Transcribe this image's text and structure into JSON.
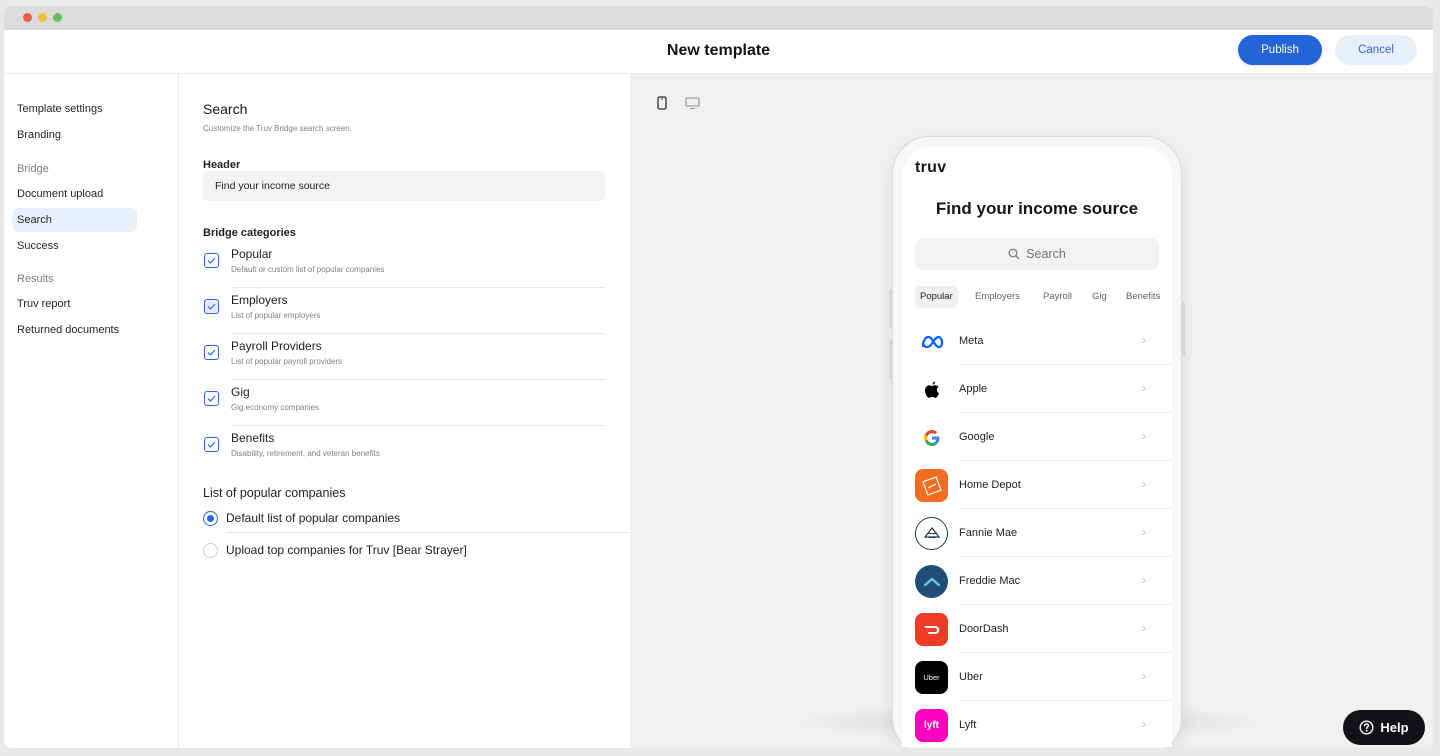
{
  "header": {
    "title": "New template",
    "publish_label": "Publish",
    "cancel_label": "Cancel"
  },
  "sidebar": {
    "items": [
      {
        "label": "Template settings",
        "type": "item"
      },
      {
        "label": "Branding",
        "type": "item"
      },
      {
        "label": "Bridge",
        "type": "group"
      },
      {
        "label": "Document upload",
        "type": "item"
      },
      {
        "label": "Search",
        "type": "item",
        "active": true
      },
      {
        "label": "Success",
        "type": "item"
      },
      {
        "label": "Results",
        "type": "group"
      },
      {
        "label": "Truv report",
        "type": "item"
      },
      {
        "label": "Returned documents",
        "type": "item"
      }
    ]
  },
  "settings": {
    "title": "Search",
    "subtitle": "Customize the Truv Bridge search screen.",
    "header_label": "Header",
    "header_value": "Find your income source",
    "categories_label": "Bridge categories",
    "categories": [
      {
        "name": "Popular",
        "desc": "Default or custom list of popular companies",
        "checked": true
      },
      {
        "name": "Employers",
        "desc": "List of popular employers",
        "checked": true
      },
      {
        "name": "Payroll Providers",
        "desc": "List of popular payroll providers",
        "checked": true
      },
      {
        "name": "Gig",
        "desc": "Gig economy companies",
        "checked": true
      },
      {
        "name": "Benefits",
        "desc": "Disability, retirement, and veteran benefits",
        "checked": true
      }
    ],
    "popular_label": "List of popular companies",
    "popular_options": [
      {
        "label": "Default list of popular companies",
        "selected": true
      },
      {
        "label": "Upload top companies for Truv [Bear Strayer]",
        "selected": false
      }
    ]
  },
  "preview": {
    "device_icons": [
      "mobile-icon",
      "desktop-icon"
    ],
    "logo": "truv",
    "title": "Find your income source",
    "search_placeholder": "Search",
    "tabs": [
      "Popular",
      "Employers",
      "Payroll",
      "Gig",
      "Benefits"
    ],
    "active_tab": "Popular",
    "companies": [
      {
        "name": "Meta",
        "icon": "meta-logo",
        "color": "#0866ff"
      },
      {
        "name": "Apple",
        "icon": "apple-logo",
        "color": "#000000"
      },
      {
        "name": "Google",
        "icon": "google-logo",
        "color": "#4285f4"
      },
      {
        "name": "Home Depot",
        "icon": "home-depot-logo",
        "color": "#f26c22"
      },
      {
        "name": "Fannie Mae",
        "icon": "fannie-mae-logo",
        "color": "#1d3b53"
      },
      {
        "name": "Freddie Mac",
        "icon": "freddie-mac-logo",
        "color": "#1f4e79"
      },
      {
        "name": "DoorDash",
        "icon": "doordash-logo",
        "color": "#ef3a25"
      },
      {
        "name": "Uber",
        "icon": "uber-logo",
        "color": "#000000",
        "text": "Uber"
      },
      {
        "name": "Lyft",
        "icon": "lyft-logo",
        "color": "#ff00bf",
        "text": "lyft"
      }
    ]
  },
  "help": {
    "label": "Help"
  }
}
